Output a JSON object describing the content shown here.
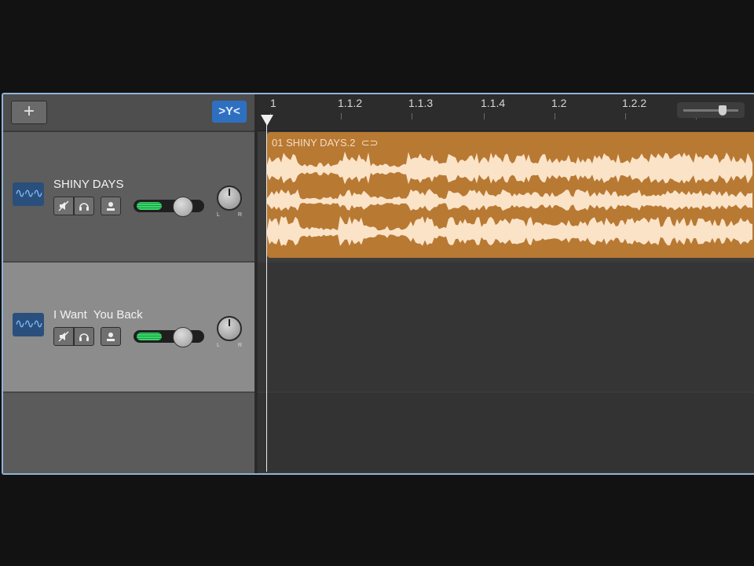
{
  "toolbar": {
    "add_track_label": "+",
    "smart_controls_label": ">Y<"
  },
  "tracks": [
    {
      "name": "SHINY DAYS",
      "icon": "waveform-icon",
      "volume_level": 0.7,
      "meter_level": 0.45,
      "pan_labels": [
        "L",
        "R"
      ]
    },
    {
      "name": "I Want  You Back",
      "icon": "waveform-icon",
      "volume_level": 0.7,
      "meter_level": 0.45,
      "pan_labels": [
        "L",
        "R"
      ]
    }
  ],
  "ruler": {
    "ticks": [
      "1",
      "1.1.2",
      "1.1.3",
      "1.1.4",
      "1.2",
      "1.2.2"
    ]
  },
  "region": {
    "name": "01 SHINY DAYS.2",
    "loop_icon": "loop-icon"
  },
  "zoom": {
    "level": 0.7
  },
  "colors": {
    "accent": "#2f6fc0",
    "region": "#b87933",
    "waveform": "#fbe3c8",
    "meter": "#3ad46a",
    "window_border": "#8fb4d8"
  }
}
